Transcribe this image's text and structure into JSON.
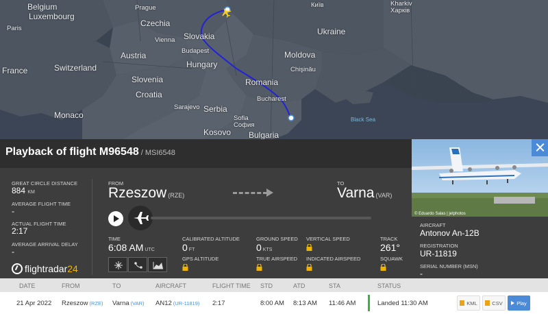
{
  "map": {
    "labels": {
      "belgium": "Belgium",
      "luxembourg": "Luxembourg",
      "paris": "Paris",
      "prague": "Prague",
      "czechia": "Czechia",
      "kyiv": "Київ",
      "kharkiv": "Kharkiv",
      "kharkiv_local": "Харків",
      "ukraine": "Ukraine",
      "france": "France",
      "switzerland": "Switzerland",
      "austria": "Austria",
      "vienna": "Vienna",
      "slovakia": "Slovakia",
      "budapest": "Budapest",
      "hungary": "Hungary",
      "moldova": "Moldova",
      "chisinau": "Chişinău",
      "slovenia": "Slovenia",
      "croatia": "Croatia",
      "romania": "Romania",
      "bucharest": "Bucharest",
      "monaco": "Monaco",
      "sarajevo": "Sarajevo",
      "serbia": "Serbia",
      "sofia": "Sofia",
      "sofia_local": "София",
      "kosovo": "Kosovo",
      "bulgaria": "Bulgaria",
      "black_sea": "Black Sea"
    }
  },
  "flight": {
    "title": "Playback of flight M96548",
    "callsign": "/ MSI6548",
    "great_circle_label": "GREAT CIRCLE DISTANCE",
    "great_circle_value": "884",
    "great_circle_unit": "KM",
    "avg_flight_time_label": "AVERAGE FLIGHT TIME",
    "avg_flight_time_value": "-",
    "actual_flight_time_label": "ACTUAL FLIGHT TIME",
    "actual_flight_time_value": "2:17",
    "avg_arrival_delay_label": "AVERAGE ARRIVAL DELAY",
    "avg_arrival_delay_value": "-",
    "from_label": "FROM",
    "from_city": "Rzeszow",
    "from_code": "(RZE)",
    "to_label": "TO",
    "to_city": "Varna",
    "to_code": "(VAR)",
    "time_label": "TIME",
    "time_value": "6:08 AM",
    "time_unit": "UTC",
    "cal_alt_label": "CALIBRATED ALTITUDE",
    "cal_alt_value": "0",
    "cal_alt_unit": "FT",
    "gps_alt_label": "GPS ALTITUDE",
    "ground_speed_label": "GROUND SPEED",
    "ground_speed_value": "0",
    "ground_speed_unit": "KTS",
    "true_airspeed_label": "TRUE AIRSPEED",
    "vertical_speed_label": "VERTICAL SPEED",
    "indicated_airspeed_label": "INDICATED AIRSPEED",
    "track_label": "TRACK",
    "track_value": "261°",
    "squawk_label": "SQUAWK"
  },
  "logo": {
    "name": "flightradar",
    "num": "24"
  },
  "aircraft": {
    "photo_credit": "© Eduardo Salas | jetphotos",
    "aircraft_label": "AIRCRAFT",
    "aircraft_value": "Antonov An-12B",
    "registration_label": "REGISTRATION",
    "registration_value": "UR-11819",
    "serial_label": "SERIAL NUMBER (MSN)",
    "serial_value": "-"
  },
  "table": {
    "headers": [
      "DATE",
      "FROM",
      "TO",
      "AIRCRAFT",
      "FLIGHT TIME",
      "STD",
      "ATD",
      "STA",
      "STATUS"
    ],
    "row": {
      "date": "21 Apr 2022",
      "from": "Rzeszow",
      "from_code": "(RZE)",
      "to": "Varna",
      "to_code": "(VAR)",
      "aircraft": "AN12",
      "aircraft_reg": "(UR-11819)",
      "flight_time": "2:17",
      "std": "8:00 AM",
      "atd": "8:13 AM",
      "sta": "11:46 AM",
      "status": "Landed 11:30 AM",
      "kml": "KML",
      "csv": "CSV",
      "play": "Play"
    }
  },
  "colors": {
    "route": "#2323d6",
    "status_green": "#3cb043",
    "accent_blue": "#4b8ad6",
    "logo_yellow": "#f5b400"
  }
}
